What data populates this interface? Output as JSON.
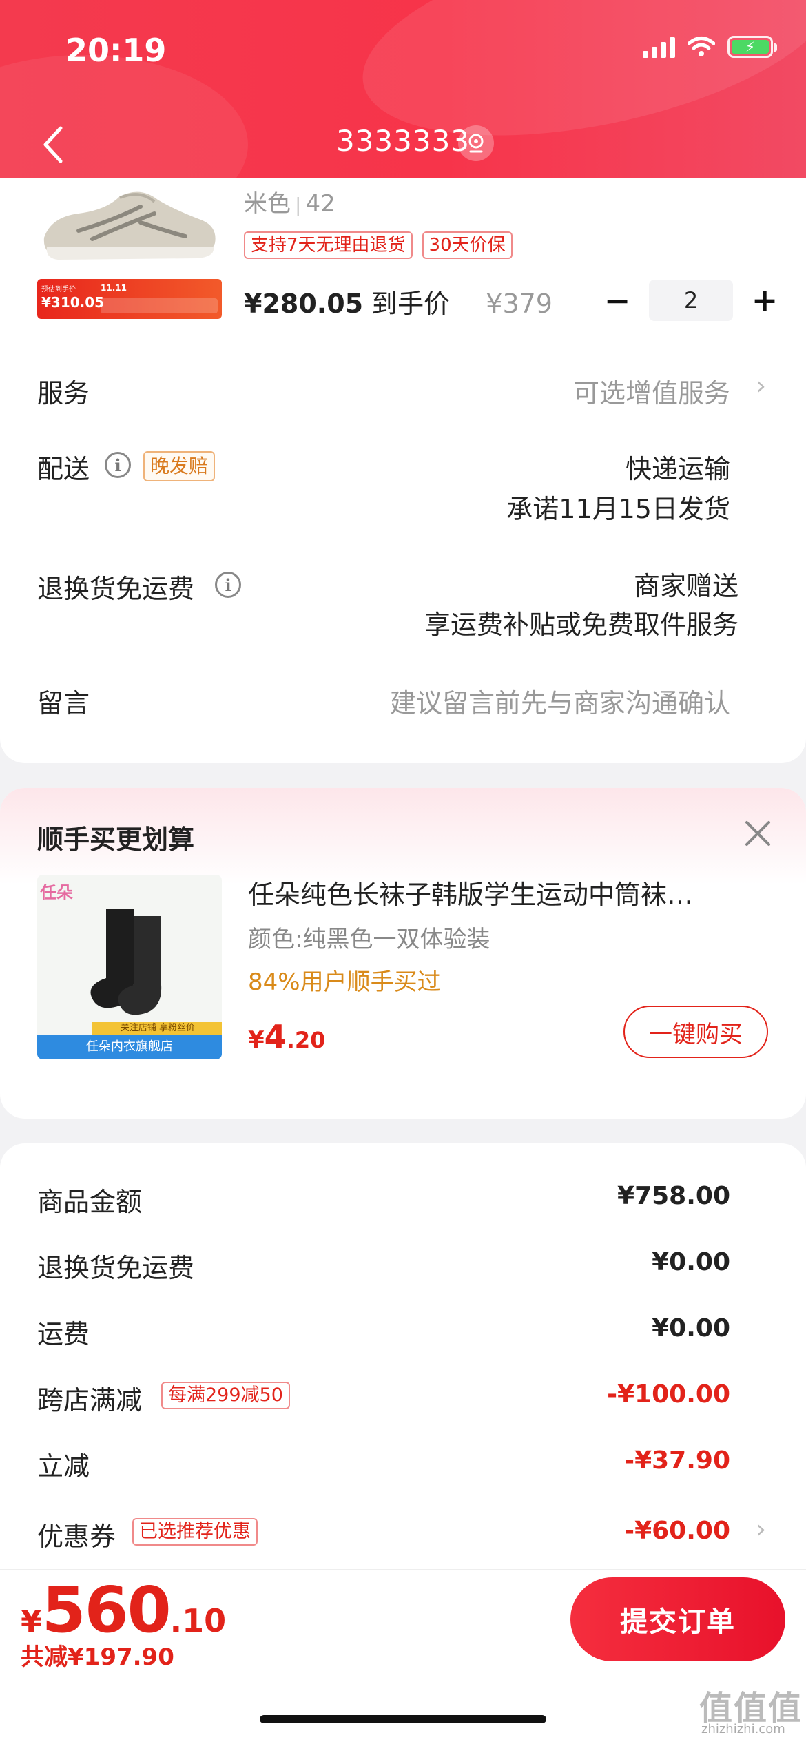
{
  "status_bar": {
    "time": "20:19"
  },
  "nav": {
    "title": "3333333"
  },
  "product": {
    "sku": "米色",
    "size": "42",
    "tags": [
      "支持7天无理由退货",
      "30天价保"
    ],
    "price_amount": "¥280.05",
    "price_suffix": "到手价",
    "original_price": "¥379",
    "quantity": "2",
    "promo_image_text": {
      "pre": "预估到手价",
      "price": "¥310.05",
      "badge": "11.11"
    }
  },
  "rows": {
    "service_label": "服务",
    "service_value": "可选增值服务",
    "delivery_label": "配送",
    "delivery_tag": "晚发赔",
    "delivery_line1": "快递运输",
    "delivery_line2": "承诺11月15日发货",
    "return_label": "退换货免运费",
    "return_line1": "商家赠送",
    "return_line2": "享运费补贴或免费取件服务",
    "note_label": "留言",
    "note_placeholder": "建议留言前先与商家沟通确认"
  },
  "upsell": {
    "title": "顺手买更划算",
    "product_name": "任朵纯色长袜子韩版学生运动中筒袜…",
    "color": "颜色:纯黑色一双体验装",
    "rate": "84%用户顺手买过",
    "price_symbol": "¥",
    "price_int": "4",
    "price_dec": ".20",
    "buy_label": "一键购买",
    "image_text": {
      "brand": "任朵",
      "banner": "任朵内衣旗舰店",
      "ribbon": "关注店铺 享粉丝价"
    }
  },
  "summary": {
    "goods_label": "商品金额",
    "goods_value": "¥758.00",
    "return_label": "退换货免运费",
    "return_value": "¥0.00",
    "shipping_label": "运费",
    "shipping_value": "¥0.00",
    "cross_label": "跨店满减",
    "cross_tag": "每满299减50",
    "cross_value": "-¥100.00",
    "instant_label": "立减",
    "instant_value": "-¥37.90",
    "coupon_label": "优惠券",
    "coupon_tag": "已选推荐优惠",
    "coupon_value": "-¥60.00"
  },
  "footer": {
    "total_symbol": "¥",
    "total_int": "560",
    "total_dec": ".10",
    "saved": "共减¥197.90",
    "submit_label": "提交订单"
  },
  "watermark": {
    "text": "值值值",
    "url": "zhizhizhi.com"
  },
  "colors": {
    "accent": "#e2231a",
    "header": "#f43a4e",
    "gold": "#d98a1a"
  }
}
